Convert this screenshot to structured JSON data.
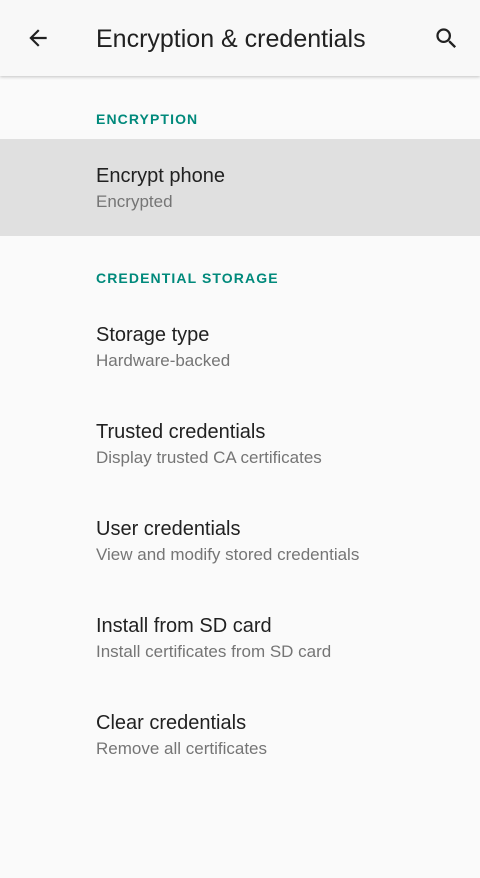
{
  "colors": {
    "accent": "#00897b",
    "background": "#fafafa",
    "selected_row": "#e0e0e0",
    "primary_text": "#212121",
    "secondary_text": "#757575"
  },
  "toolbar": {
    "back_icon": "arrow-back-icon",
    "title": "Encryption & credentials",
    "search_icon": "search-icon"
  },
  "sections": [
    {
      "header": "ENCRYPTION",
      "items": [
        {
          "title": "Encrypt phone",
          "summary": "Encrypted",
          "selected": true
        }
      ]
    },
    {
      "header": "CREDENTIAL STORAGE",
      "items": [
        {
          "title": "Storage type",
          "summary": "Hardware-backed"
        },
        {
          "title": "Trusted credentials",
          "summary": "Display trusted CA certificates"
        },
        {
          "title": "User credentials",
          "summary": "View and modify stored credentials"
        },
        {
          "title": "Install from SD card",
          "summary": "Install certificates from SD card"
        },
        {
          "title": "Clear credentials",
          "summary": "Remove all certificates"
        }
      ]
    }
  ]
}
